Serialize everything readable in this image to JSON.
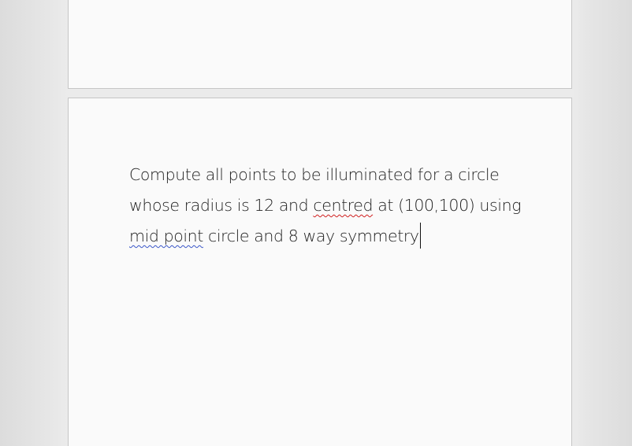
{
  "document": {
    "page_1": {},
    "page_2": {
      "lines": [
        {
          "before": "Compute all points to be illuminated for a circle",
          "flagged": "",
          "after": ""
        },
        {
          "before": "whose radius is 12 and ",
          "flagged": "centred",
          "after": " at (100,100) using"
        },
        {
          "before": "",
          "flagged": "mid point",
          "after": " circle and 8 way symmetry"
        }
      ]
    }
  },
  "colors": {
    "spelling_underline": "#d02020",
    "grammar_underline": "#3a56c8",
    "page_background": "#fafafa",
    "canvas_background": "#ebebeb"
  }
}
